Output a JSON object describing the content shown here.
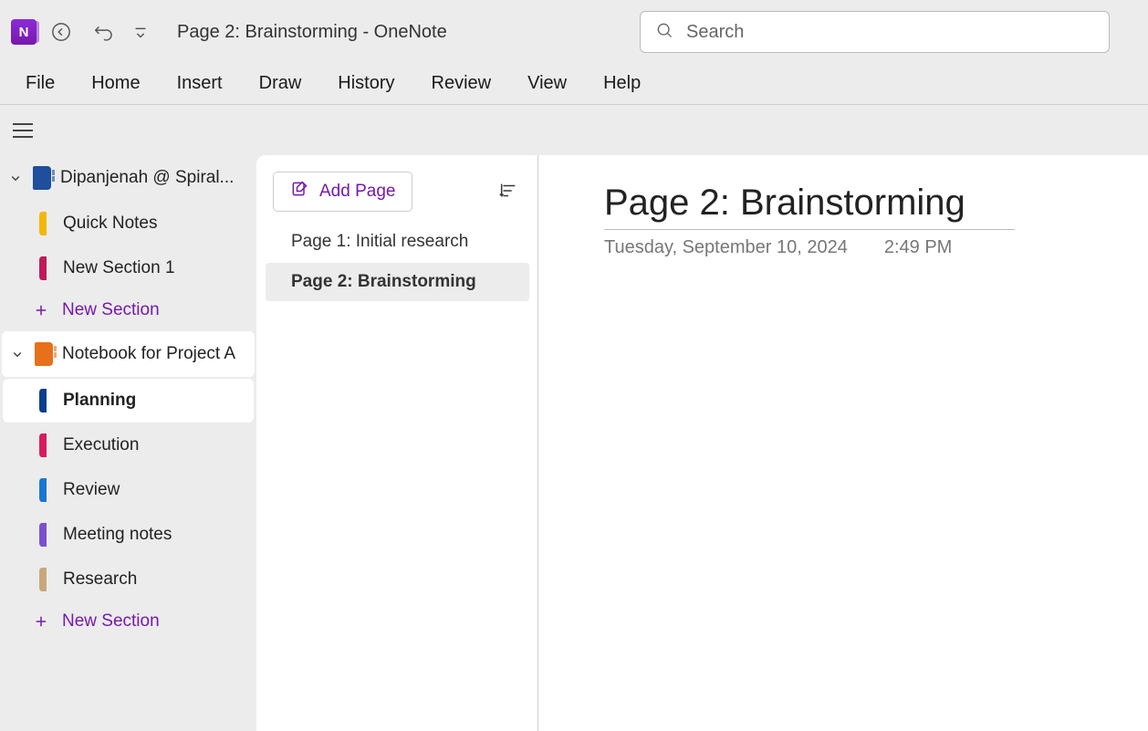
{
  "titlebar": {
    "title": "Page 2: Brainstorming  -  OneNote",
    "search_placeholder": "Search"
  },
  "menu": [
    "File",
    "Home",
    "Insert",
    "Draw",
    "History",
    "Review",
    "View",
    "Help"
  ],
  "notebooks": [
    {
      "label": "Dipanjenah @ Spiral...",
      "color": "#1e4e9c",
      "expanded": true,
      "selected": false,
      "sections": [
        {
          "label": "Quick Notes",
          "color": "#f2b705",
          "selected": false
        },
        {
          "label": "New Section 1",
          "color": "#c2185b",
          "selected": false
        }
      ]
    },
    {
      "label": "Notebook for Project A",
      "color": "#e8701a",
      "expanded": true,
      "selected": true,
      "sections": [
        {
          "label": "Planning",
          "color": "#0b3e91",
          "selected": true
        },
        {
          "label": "Execution",
          "color": "#d81b60",
          "selected": false
        },
        {
          "label": "Review",
          "color": "#1976d2",
          "selected": false
        },
        {
          "label": "Meeting notes",
          "color": "#7b4fd1",
          "selected": false
        },
        {
          "label": "Research",
          "color": "#c9a77a",
          "selected": false
        }
      ]
    }
  ],
  "new_section_label": "New Section",
  "pages_panel": {
    "add_label": "Add Page",
    "pages": [
      {
        "label": "Page 1: Initial research",
        "selected": false
      },
      {
        "label": "Page 2: Brainstorming",
        "selected": true
      }
    ]
  },
  "canvas": {
    "title": "Page 2: Brainstorming",
    "date": "Tuesday, September 10, 2024",
    "time": "2:49 PM"
  }
}
